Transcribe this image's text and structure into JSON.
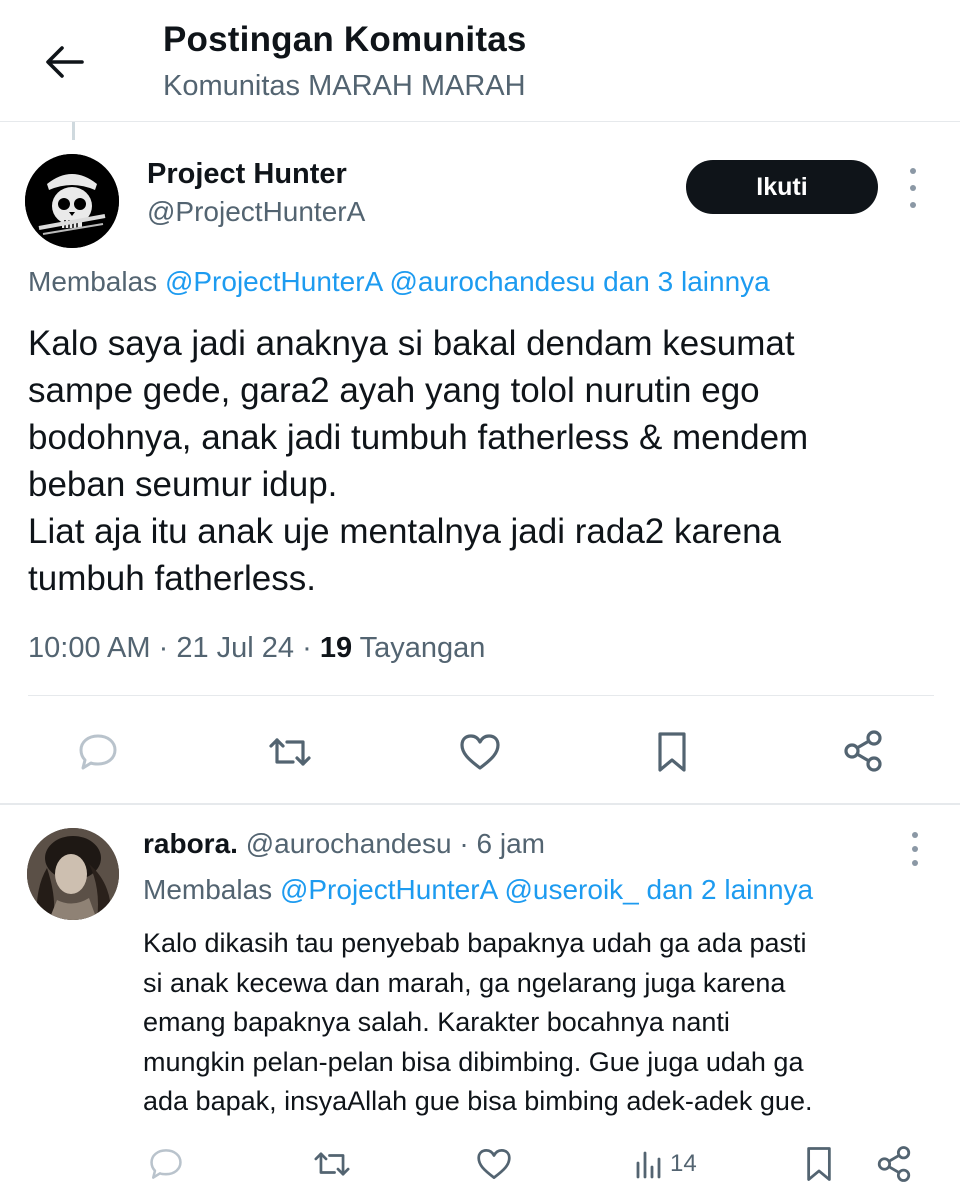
{
  "header": {
    "title": "Postingan Komunitas",
    "subtitle": "Komunitas MARAH MARAH",
    "back_icon": "arrow-left-icon"
  },
  "post": {
    "author_name": "Project Hunter",
    "author_handle": "@ProjectHunterA",
    "follow_label": "Ikuti",
    "reply_prefix": "Membalas",
    "reply_mentions": "@ProjectHunterA @aurochandesu dan 3 lainnya",
    "body_lines": [
      "Kalo saya jadi anaknya si bakal dendam kesumat",
      "sampe gede, gara2 ayah yang tolol nurutin ego",
      "bodohnya, anak jadi tumbuh fatherless & mendem",
      "beban seumur idup.",
      "Liat aja itu anak uje mentalnya jadi rada2 karena",
      "tumbuh fatherless."
    ],
    "time": "10:00 AM",
    "date": "21 Jul 24",
    "views_count": "19",
    "views_label": "Tayangan",
    "sep": "·",
    "actions": [
      "reply-icon",
      "repost-icon",
      "like-icon",
      "bookmark-icon",
      "share-icon"
    ]
  },
  "reply": {
    "name": "rabora.",
    "handle": "@aurochandesu",
    "sep": "·",
    "time": "6 jam",
    "reply_prefix": "Membalas",
    "reply_mentions": "@ProjectHunterA @useroik_ dan 2 lainnya",
    "body_lines": [
      "Kalo dikasih tau penyebab bapaknya udah ga ada pasti",
      "si anak kecewa dan marah, ga ngelarang juga karena",
      "emang bapaknya salah. Karakter bocahnya nanti",
      "mungkin pelan-pelan bisa dibimbing. Gue juga udah ga",
      "ada bapak, insyaAllah gue bisa bimbing adek-adek gue."
    ],
    "views_count": "14",
    "actions": [
      "reply-icon",
      "repost-icon",
      "like-icon",
      "views-icon",
      "bookmark-icon",
      "share-icon"
    ]
  },
  "colors": {
    "text": "#0f1419",
    "muted": "#536471",
    "link": "#1d9bf0",
    "border": "#e6e9ec",
    "button": "#0f1419"
  }
}
